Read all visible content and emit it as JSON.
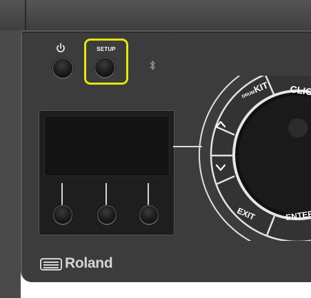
{
  "device": {
    "brand": "Roland",
    "highlight_color": "#e8e800"
  },
  "top_buttons": {
    "power": {
      "icon": "power-icon"
    },
    "setup": {
      "label": "SETUP"
    },
    "bluetooth": {
      "icon": "bluetooth-icon"
    }
  },
  "function_buttons": [
    {
      "name": "function-button-1"
    },
    {
      "name": "function-button-2"
    },
    {
      "name": "function-button-3"
    }
  ],
  "dial_ring": {
    "drum_small": "DRUM",
    "kit": "KIT",
    "click": "CLICK",
    "exit": "EXIT",
    "enter": "ENTER",
    "up_icon": "chevron-up-icon",
    "down_icon": "chevron-down-icon"
  }
}
